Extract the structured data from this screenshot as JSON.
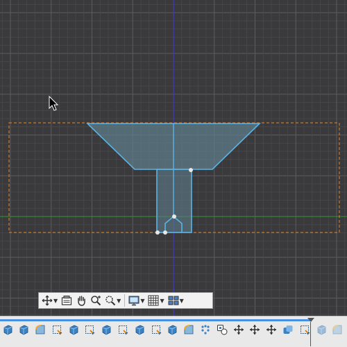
{
  "colors": {
    "canvas_background": "#3a3a3c",
    "grid_minor": "#4a4a4c",
    "grid_major": "#5c5c5e",
    "axis_x": "#2f8a2f",
    "axis_y": "#3a3ad0",
    "sketch_line": "#5ab4e6",
    "sketch_fill": "#5d7c8a",
    "bounding_box": "#c9782f",
    "timeline_accent": "#4a90e2"
  },
  "navigation_bar": {
    "buttons": [
      {
        "name": "orbit",
        "icon": "orbit-icon",
        "has_dropdown": true
      },
      {
        "name": "look-at",
        "icon": "look-at-icon",
        "has_dropdown": false
      },
      {
        "name": "pan",
        "icon": "hand-icon",
        "has_dropdown": false
      },
      {
        "name": "zoom",
        "icon": "zoom-icon",
        "has_dropdown": false
      },
      {
        "name": "fit",
        "icon": "zoom-window-icon",
        "has_dropdown": true
      },
      {
        "name": "display-settings",
        "icon": "monitor-icon",
        "has_dropdown": true
      },
      {
        "name": "grid-snaps",
        "icon": "grid-icon",
        "has_dropdown": true
      },
      {
        "name": "viewports",
        "icon": "viewports-icon",
        "has_dropdown": true
      }
    ]
  },
  "timeline": {
    "features": [
      {
        "type": "extrude",
        "icon": "extrude-icon"
      },
      {
        "type": "extrude",
        "icon": "extrude-icon"
      },
      {
        "type": "fillet",
        "icon": "fillet-icon"
      },
      {
        "type": "sketch",
        "icon": "sketch-icon"
      },
      {
        "type": "extrude",
        "icon": "extrude-icon"
      },
      {
        "type": "sketch",
        "icon": "sketch-icon"
      },
      {
        "type": "extrude",
        "icon": "extrude-icon"
      },
      {
        "type": "sketch",
        "icon": "sketch-icon"
      },
      {
        "type": "extrude",
        "icon": "extrude-icon"
      },
      {
        "type": "sketch",
        "icon": "sketch-icon"
      },
      {
        "type": "extrude",
        "icon": "extrude-icon"
      },
      {
        "type": "fillet",
        "icon": "fillet-icon"
      },
      {
        "type": "pattern",
        "icon": "pattern-icon"
      },
      {
        "type": "component",
        "icon": "component-icon"
      },
      {
        "type": "move",
        "icon": "move-icon"
      },
      {
        "type": "move",
        "icon": "move-icon"
      },
      {
        "type": "move",
        "icon": "move-icon"
      },
      {
        "type": "combine",
        "icon": "combine-icon"
      },
      {
        "type": "sketch",
        "icon": "sketch-icon"
      },
      {
        "type": "extrude",
        "icon": "extrude-icon",
        "suppressed": true
      },
      {
        "type": "fillet",
        "icon": "fillet-icon",
        "suppressed": true
      }
    ]
  }
}
